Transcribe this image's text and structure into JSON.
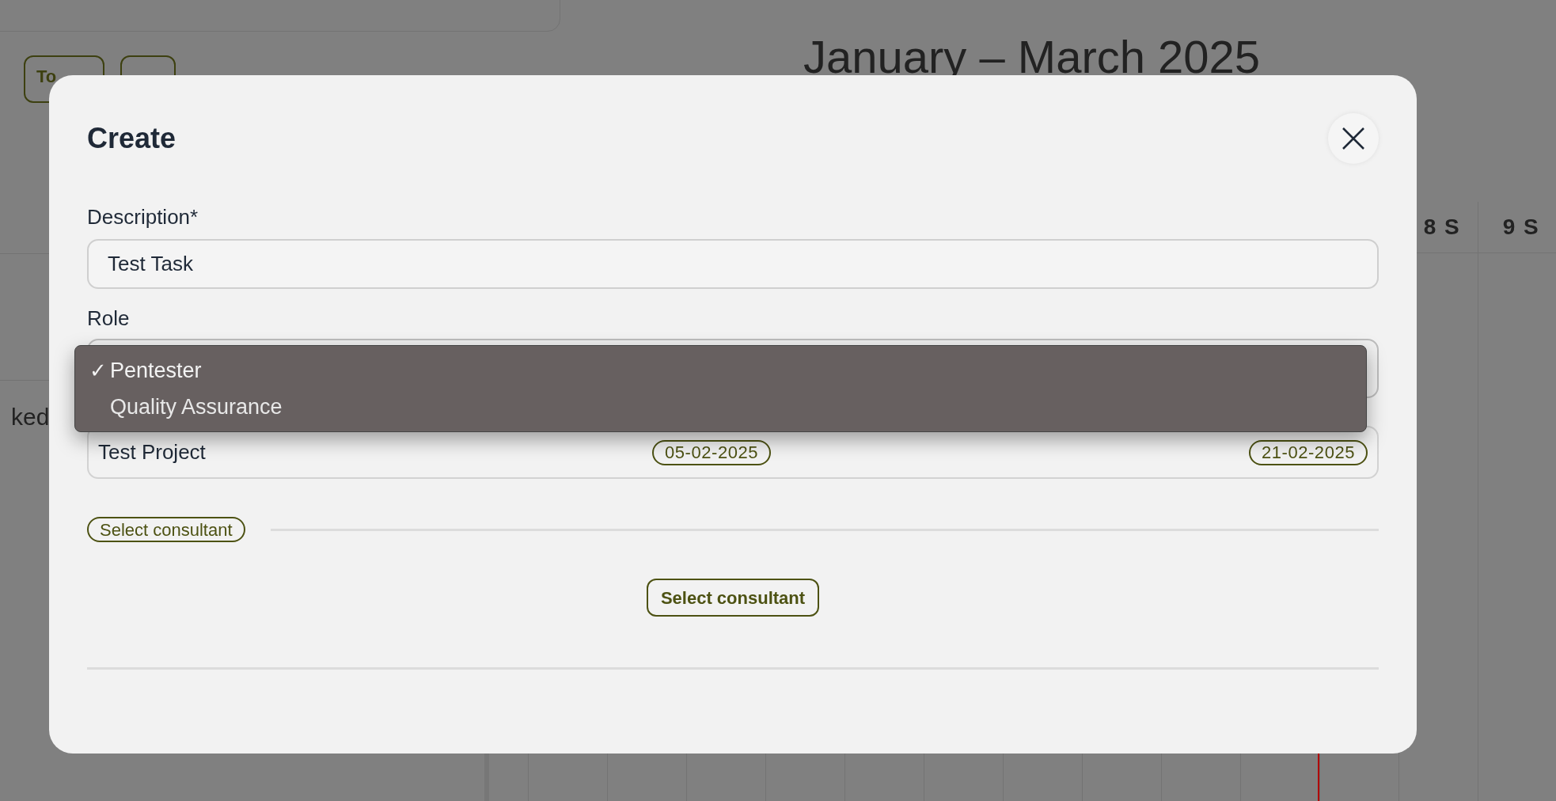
{
  "background": {
    "nav_buttons": [
      {
        "label": "To"
      }
    ],
    "period_title": "January – March 2025",
    "day_columns": [
      "8 S",
      "9 S"
    ],
    "row_label": "ked"
  },
  "dialog": {
    "title": "Create",
    "fields": [
      {
        "label": "Description*",
        "value": "Test Task"
      },
      {
        "label": "Role"
      }
    ],
    "selected_mark": "✓",
    "role_options": [
      {
        "label": "Pentester",
        "selected": true
      },
      {
        "label": "Quality Assurance",
        "selected": false
      }
    ],
    "project": {
      "name": "Test Project",
      "start": "05-02-2025",
      "end": "21-02-2025"
    },
    "consultant_tag": "Select consultant",
    "button": "Select consultant"
  }
}
